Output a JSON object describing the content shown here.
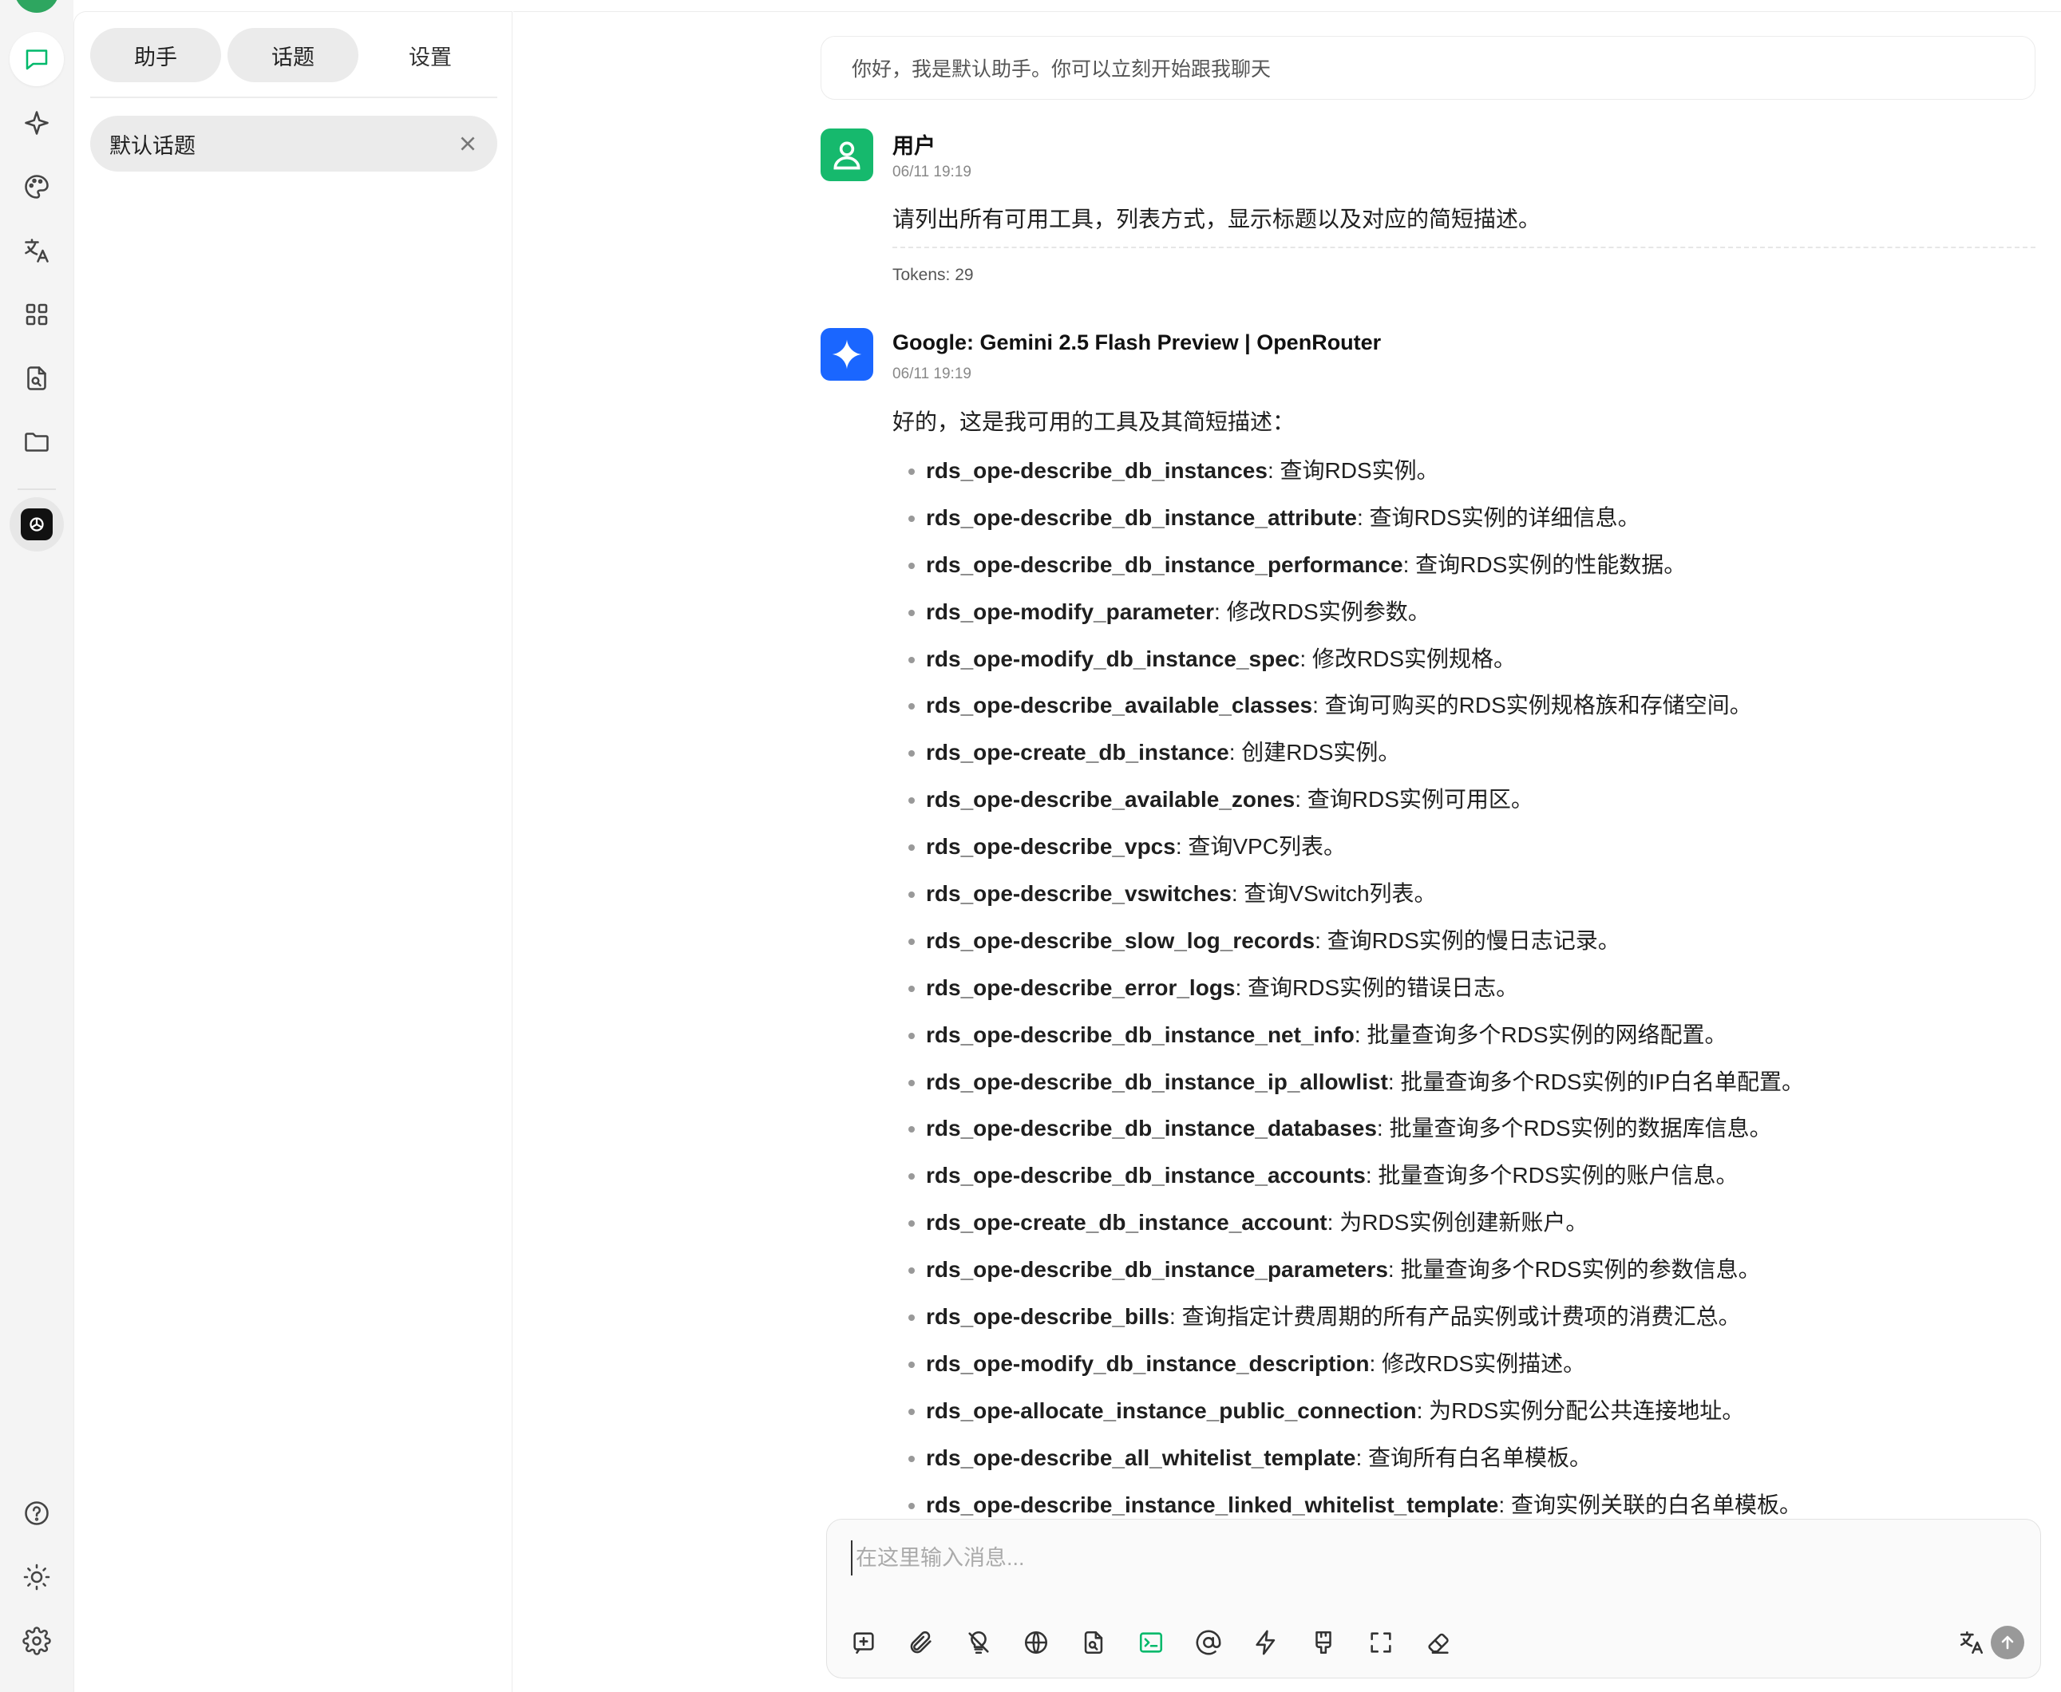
{
  "sidebar_tabs": {
    "assistant": "助手",
    "topics": "话题",
    "settings": "设置"
  },
  "topic_list": [
    {
      "label": "默认话题"
    }
  ],
  "chat": {
    "welcome": "你好，我是默认助手。你可以立刻开始跟我聊天",
    "user_message": {
      "sender": "用户",
      "time": "06/11 19:19",
      "text": "请列出所有可用工具，列表方式，显示标题以及对应的简短描述。",
      "tokens": "Tokens: 29"
    },
    "bot_message": {
      "sender": "Google: Gemini 2.5 Flash Preview | OpenRouter",
      "time": "06/11 19:19",
      "intro": "好的，这是我可用的工具及其简短描述：",
      "tools": [
        {
          "name": "rds_ope-describe_db_instances",
          "desc": ": 查询RDS实例。"
        },
        {
          "name": "rds_ope-describe_db_instance_attribute",
          "desc": ": 查询RDS实例的详细信息。"
        },
        {
          "name": "rds_ope-describe_db_instance_performance",
          "desc": ": 查询RDS实例的性能数据。"
        },
        {
          "name": "rds_ope-modify_parameter",
          "desc": ": 修改RDS实例参数。"
        },
        {
          "name": "rds_ope-modify_db_instance_spec",
          "desc": ": 修改RDS实例规格。"
        },
        {
          "name": "rds_ope-describe_available_classes",
          "desc": ": 查询可购买的RDS实例规格族和存储空间。"
        },
        {
          "name": "rds_ope-create_db_instance",
          "desc": ": 创建RDS实例。"
        },
        {
          "name": "rds_ope-describe_available_zones",
          "desc": ": 查询RDS实例可用区。"
        },
        {
          "name": "rds_ope-describe_vpcs",
          "desc": ": 查询VPC列表。"
        },
        {
          "name": "rds_ope-describe_vswitches",
          "desc": ": 查询VSwitch列表。"
        },
        {
          "name": "rds_ope-describe_slow_log_records",
          "desc": ": 查询RDS实例的慢日志记录。"
        },
        {
          "name": "rds_ope-describe_error_logs",
          "desc": ": 查询RDS实例的错误日志。"
        },
        {
          "name": "rds_ope-describe_db_instance_net_info",
          "desc": ": 批量查询多个RDS实例的网络配置。"
        },
        {
          "name": "rds_ope-describe_db_instance_ip_allowlist",
          "desc": ": 批量查询多个RDS实例的IP白名单配置。"
        },
        {
          "name": "rds_ope-describe_db_instance_databases",
          "desc": ": 批量查询多个RDS实例的数据库信息。"
        },
        {
          "name": "rds_ope-describe_db_instance_accounts",
          "desc": ": 批量查询多个RDS实例的账户信息。"
        },
        {
          "name": "rds_ope-create_db_instance_account",
          "desc": ": 为RDS实例创建新账户。"
        },
        {
          "name": "rds_ope-describe_db_instance_parameters",
          "desc": ": 批量查询多个RDS实例的参数信息。"
        },
        {
          "name": "rds_ope-describe_bills",
          "desc": ": 查询指定计费周期的所有产品实例或计费项的消费汇总。"
        },
        {
          "name": "rds_ope-modify_db_instance_description",
          "desc": ": 修改RDS实例描述。"
        },
        {
          "name": "rds_ope-allocate_instance_public_connection",
          "desc": ": 为RDS实例分配公共连接地址。"
        },
        {
          "name": "rds_ope-describe_all_whitelist_template",
          "desc": ": 查询所有白名单模板。"
        },
        {
          "name": "rds_ope-describe_instance_linked_whitelist_template",
          "desc": ": 查询实例关联的白名单模板。"
        }
      ]
    }
  },
  "composer": {
    "placeholder": "在这里输入消息..."
  },
  "rail_icons": [
    "chat-icon",
    "sparkle-icon",
    "palette-icon",
    "translate-icon",
    "apps-icon",
    "file-search-icon",
    "folder-icon",
    "openai-app-icon",
    "help-icon",
    "theme-icon",
    "settings-icon"
  ],
  "toolbar_icons": [
    "new-topic-icon",
    "attachment-icon",
    "web-search-off-icon",
    "globe-icon",
    "file-search-icon",
    "terminal-icon",
    "mention-icon",
    "lightning-icon",
    "clear-context-icon",
    "fullscreen-icon",
    "eraser-icon",
    "translate-icon",
    "send-icon"
  ],
  "colors": {
    "accent": "#00b96b",
    "user_avatar": "#16b96d",
    "bot_avatar": "#1a66ff",
    "rail_bg": "#f4f4f4"
  }
}
